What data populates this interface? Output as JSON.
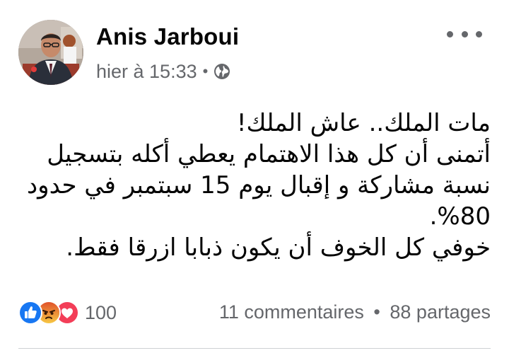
{
  "post": {
    "author": "Anis Jarboui",
    "timestamp": "hier à 15:33",
    "separator": "•",
    "audience_icon": "globe-icon",
    "menu_icon": "more-options-icon",
    "text_lines": [
      "مات الملك.. عاش الملك!",
      "أتمنى أن كل هذا الاهتمام يعطي أكله بتسجيل نسبة مشاركة و إقبال يوم 15 سبتمبر في حدود 80%.",
      "خوفي كل الخوف أن يكون ذبابا ازرقا فقط."
    ]
  },
  "footer": {
    "reaction_icons": [
      "like-icon",
      "angry-icon",
      "love-icon"
    ],
    "reaction_count": "100",
    "comments": "11 commentaires",
    "stats_separator": "•",
    "shares": "88 partages"
  },
  "colors": {
    "text_primary": "#050505",
    "text_secondary": "#65676b",
    "like_blue": "#1877f2",
    "love_red": "#f33e58",
    "angry_orange": "#e9710f",
    "divider": "#ced0d4"
  }
}
